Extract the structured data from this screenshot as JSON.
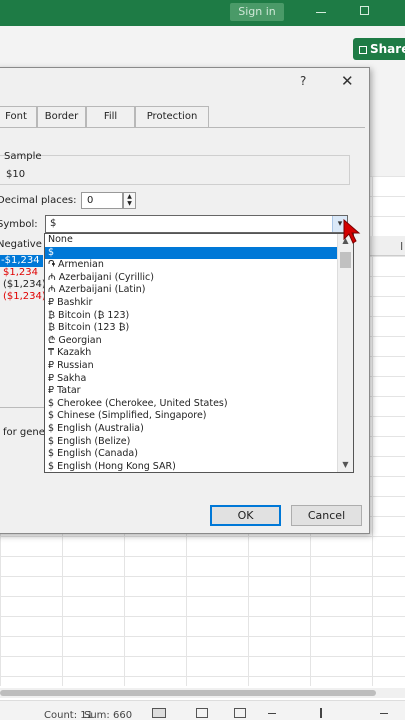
{
  "titlebar": {
    "signin_label": "Sign in"
  },
  "ribbon": {
    "share_label": "Share"
  },
  "dialog": {
    "help": "?",
    "close": "✕",
    "tabs": [
      {
        "label": "Font"
      },
      {
        "label": "Border"
      },
      {
        "label": "Fill"
      },
      {
        "label": "Protection"
      }
    ],
    "sample_label": "Sample",
    "sample_value": "$10",
    "decimal_label": "Decimal places:",
    "decimal_value": "0",
    "symbol_label": "Symbol:",
    "symbol_value": "$",
    "negative_label": "Negative",
    "negative_options": [
      "-$1,234",
      "$1,234",
      "($1,234)",
      "($1,234)"
    ],
    "desc_text": "for gene",
    "ok_label": "OK",
    "cancel_label": "Cancel"
  },
  "dropdown": {
    "items": [
      "None",
      "$",
      "֏ Armenian",
      "₼ Azerbaijani (Cyrillic)",
      "₼ Azerbaijani (Latin)",
      "₽ Bashkir",
      "₿ Bitcoin (₿ 123)",
      "₿ Bitcoin (123 ₿)",
      "₾ Georgian",
      "₸ Kazakh",
      "₽ Russian",
      "₽ Sakha",
      "₽ Tatar",
      "$ Cherokee (Cherokee, United States)",
      "$ Chinese (Simplified, Singapore)",
      "$ English (Australia)",
      "$ English (Belize)",
      "$ English (Canada)",
      "$ English (Hong Kong SAR)"
    ]
  },
  "sheet": {
    "col_label": "I"
  },
  "statusbar": {
    "count": "Count: 11",
    "sum": "Sum: 660"
  },
  "colors": {
    "accent": "#1e7b45",
    "selection": "#0078d7",
    "negative_red": "#e00000"
  }
}
